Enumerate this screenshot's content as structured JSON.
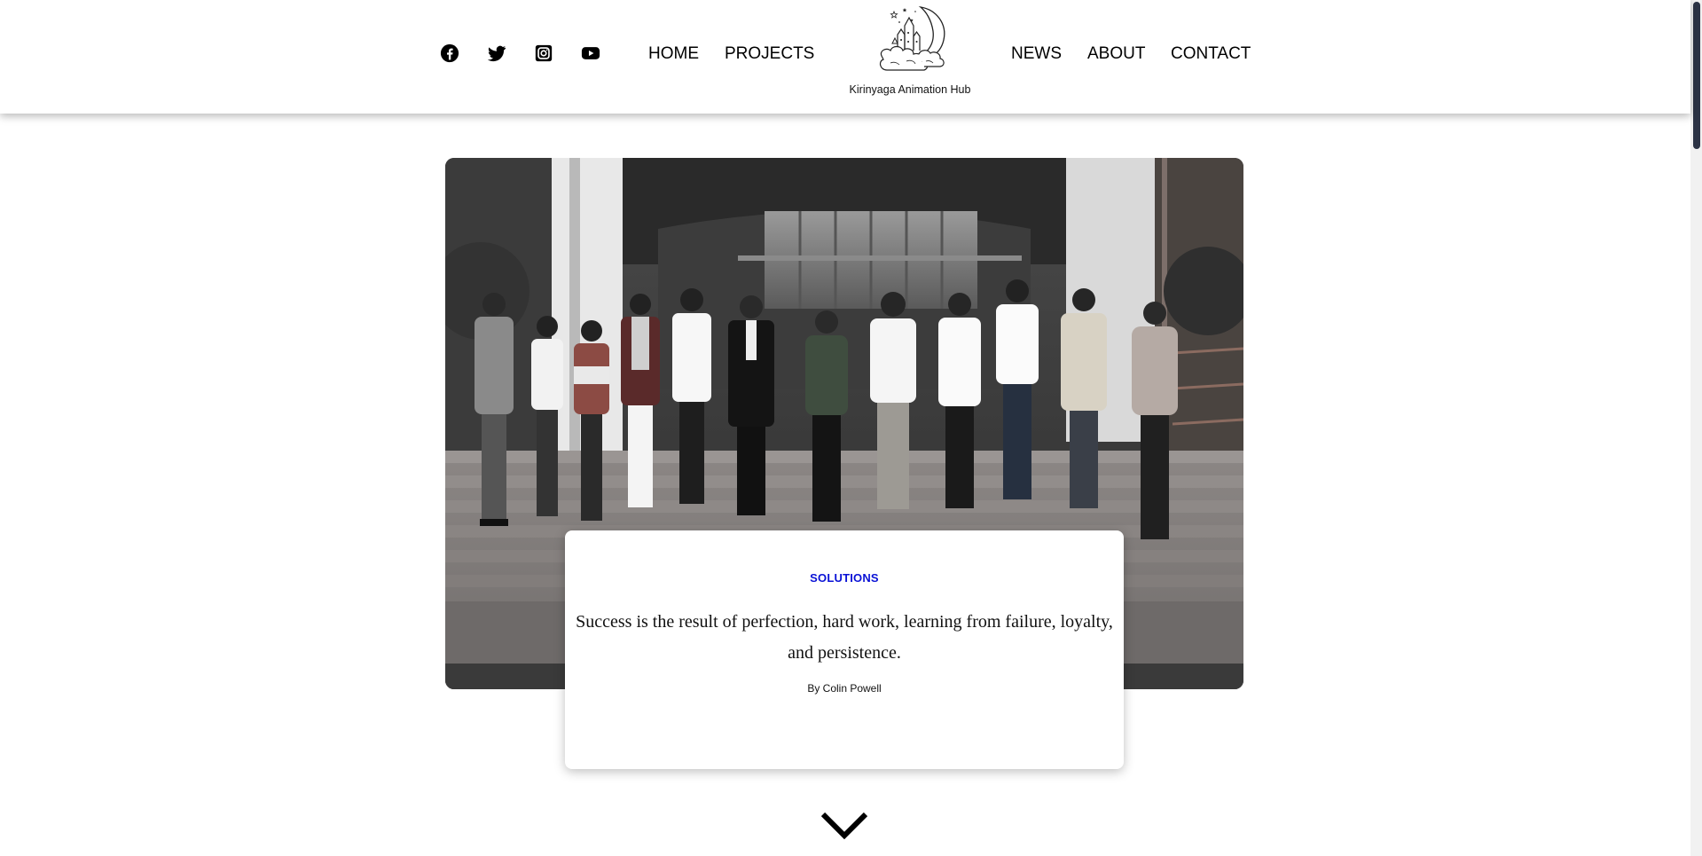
{
  "header": {
    "social": [
      {
        "name": "facebook",
        "icon": "facebook-icon"
      },
      {
        "name": "twitter",
        "icon": "twitter-icon"
      },
      {
        "name": "instagram",
        "icon": "instagram-icon"
      },
      {
        "name": "youtube",
        "icon": "youtube-icon"
      }
    ],
    "nav_left": {
      "home": "HOME",
      "projects": "PROJECTS"
    },
    "logo_icon": "moon-castle-logo-icon",
    "brand_name": "Kirinyaga Animation Hub",
    "nav_right": {
      "news": "NEWS",
      "about": "ABOUT",
      "contact": "CONTACT"
    }
  },
  "hero": {
    "image": "group-photo-grayscale"
  },
  "card": {
    "category": "SOLUTIONS",
    "quote": "Success is the result of perfection, hard work, learning from failure, loyalty, and persistence.",
    "author": "By Colin Powell"
  },
  "scroll_down_icon": "chevron-down-icon",
  "colors": {
    "accent": "#0a12d6",
    "text": "#000000",
    "scroll_thumb": "#2c3345"
  }
}
